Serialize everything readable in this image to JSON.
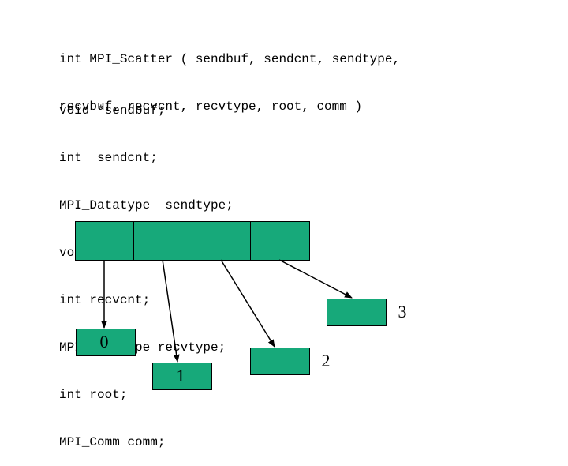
{
  "code": {
    "sig1": "int MPI_Scatter ( sendbuf, sendcnt, sendtype,",
    "sig2": "recvbuf, recvcnt, recvtype, root, comm )",
    "d1": "void *sendbuf;",
    "d2": "int  sendcnt;",
    "d3": "MPI_Datatype  sendtype;",
    "d4": "void *recvbuf;",
    "d5": "int recvcnt;",
    "d6": "MPI_Datatype recvtype;",
    "d7": "int root;",
    "d8": "MPI_Comm comm;"
  },
  "boxes": {
    "b0": "0",
    "b1": "1",
    "b2": "2",
    "b3": "3"
  },
  "colors": {
    "fill": "#17a97a"
  }
}
